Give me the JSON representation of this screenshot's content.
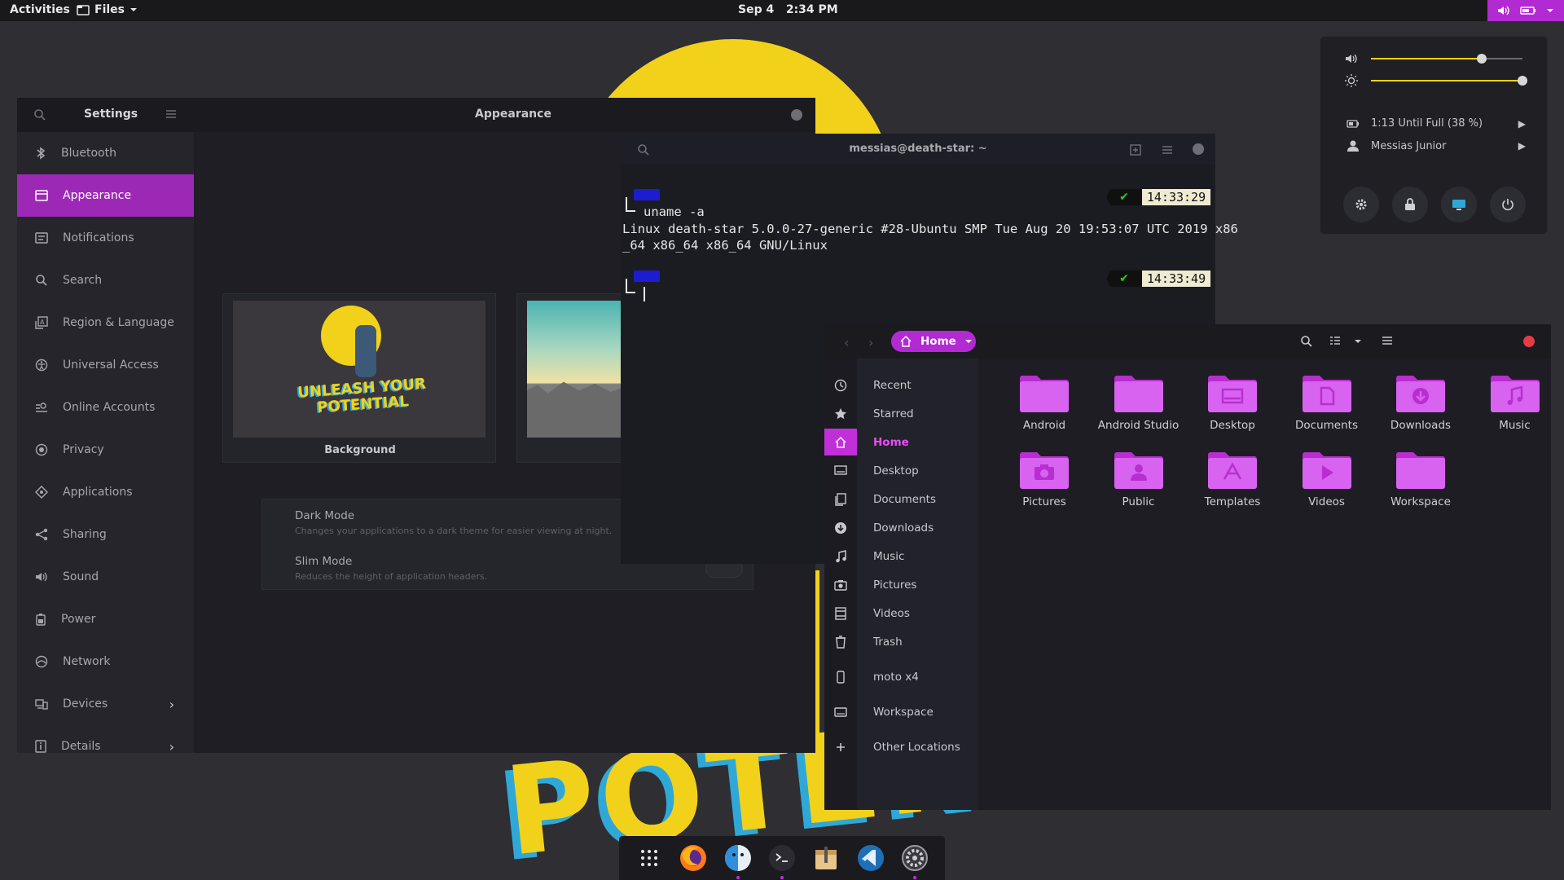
{
  "colors": {
    "accent": "#b22ad2",
    "accent_light": "#e84ef5",
    "wallpaper_yellow": "#f2d11a",
    "terminal_prompt_blue": "#1c1cd1"
  },
  "topbar": {
    "activities": "Activities",
    "app_menu": "Files",
    "clock": "Sep 4   2:34 PM",
    "tray_icons": [
      "volume-icon",
      "battery-icon",
      "dropdown-arrow-icon"
    ]
  },
  "system_menu": {
    "volume_level": 0.73,
    "brightness_level": 1.0,
    "battery": "1:13 Until Full (38 %)",
    "user": "Messias Junior",
    "buttons": [
      "settings-icon",
      "lock-icon",
      "screen-icon",
      "power-icon"
    ]
  },
  "settings": {
    "title": "Settings",
    "panel_title": "Appearance",
    "nav": [
      {
        "label": "Bluetooth",
        "icon": "bluetooth-icon"
      },
      {
        "label": "Appearance",
        "icon": "appearance-icon",
        "active": true
      },
      {
        "label": "Notifications",
        "icon": "notifications-icon"
      },
      {
        "label": "Search",
        "icon": "search-icon"
      },
      {
        "label": "Region & Language",
        "icon": "region-icon"
      },
      {
        "label": "Universal Access",
        "icon": "universal-access-icon"
      },
      {
        "label": "Online Accounts",
        "icon": "online-accounts-icon"
      },
      {
        "label": "Privacy",
        "icon": "privacy-icon"
      },
      {
        "label": "Applications",
        "icon": "applications-icon"
      },
      {
        "label": "Sharing",
        "icon": "sharing-icon"
      },
      {
        "label": "Sound",
        "icon": "sound-icon"
      },
      {
        "label": "Power",
        "icon": "power-icon"
      },
      {
        "label": "Network",
        "icon": "network-icon"
      },
      {
        "label": "Devices",
        "icon": "devices-icon",
        "chevron": true
      },
      {
        "label": "Details",
        "icon": "details-icon",
        "chevron": true
      }
    ],
    "background_label": "Background",
    "background_logo_text": "UNLEASH YOUR POTENTIAL",
    "dark_mode": {
      "title": "Dark Mode",
      "desc": "Changes your applications to a dark theme for easier viewing at night."
    },
    "slim_mode": {
      "title": "Slim Mode",
      "desc": "Reduces the height of application headers."
    }
  },
  "terminal": {
    "title": "messias@death-star: ~",
    "blocks": [
      {
        "time": "14:33:29",
        "command": "uname -a",
        "output": [
          "Linux death-star 5.0.0-27-generic #28-Ubuntu SMP Tue Aug 20 19:53:07 UTC 2019 x86",
          "_64 x86_64 x86_64 GNU/Linux"
        ]
      },
      {
        "time": "14:33:49",
        "command": "",
        "output": []
      }
    ]
  },
  "files": {
    "location": "Home",
    "places": [
      {
        "label": "Recent",
        "icon": "recent-icon"
      },
      {
        "label": "Starred",
        "icon": "star-icon"
      },
      {
        "label": "Home",
        "icon": "home-icon",
        "active": true
      },
      {
        "label": "Desktop",
        "icon": "desktop-icon"
      },
      {
        "label": "Documents",
        "icon": "documents-icon"
      },
      {
        "label": "Downloads",
        "icon": "downloads-icon"
      },
      {
        "label": "Music",
        "icon": "music-icon"
      },
      {
        "label": "Pictures",
        "icon": "pictures-icon"
      },
      {
        "label": "Videos",
        "icon": "videos-icon"
      },
      {
        "label": "Trash",
        "icon": "trash-icon"
      },
      {
        "label": "moto x4",
        "icon": "phone-icon"
      },
      {
        "label": "Workspace",
        "icon": "drive-icon"
      },
      {
        "label": "Other Locations",
        "icon": "plus-icon"
      }
    ],
    "folders": [
      {
        "name": "Android",
        "glyph": ""
      },
      {
        "name": "Android Studio",
        "glyph": ""
      },
      {
        "name": "Desktop",
        "glyph": "desktop"
      },
      {
        "name": "Documents",
        "glyph": "document"
      },
      {
        "name": "Downloads",
        "glyph": "download"
      },
      {
        "name": "Music",
        "glyph": "music"
      },
      {
        "name": "Pictures",
        "glyph": "camera"
      },
      {
        "name": "Public",
        "glyph": "person"
      },
      {
        "name": "Templates",
        "glyph": "template"
      },
      {
        "name": "Videos",
        "glyph": "play"
      },
      {
        "name": "Workspace",
        "glyph": ""
      }
    ]
  },
  "dock": {
    "apps": [
      {
        "name": "app-grid-icon",
        "running": false
      },
      {
        "name": "firefox-icon",
        "running": false
      },
      {
        "name": "files-icon",
        "running": true
      },
      {
        "name": "terminal-icon",
        "running": true
      },
      {
        "name": "archive-manager-icon",
        "running": false
      },
      {
        "name": "vscode-icon",
        "running": false
      },
      {
        "name": "settings-icon",
        "running": true
      }
    ]
  }
}
